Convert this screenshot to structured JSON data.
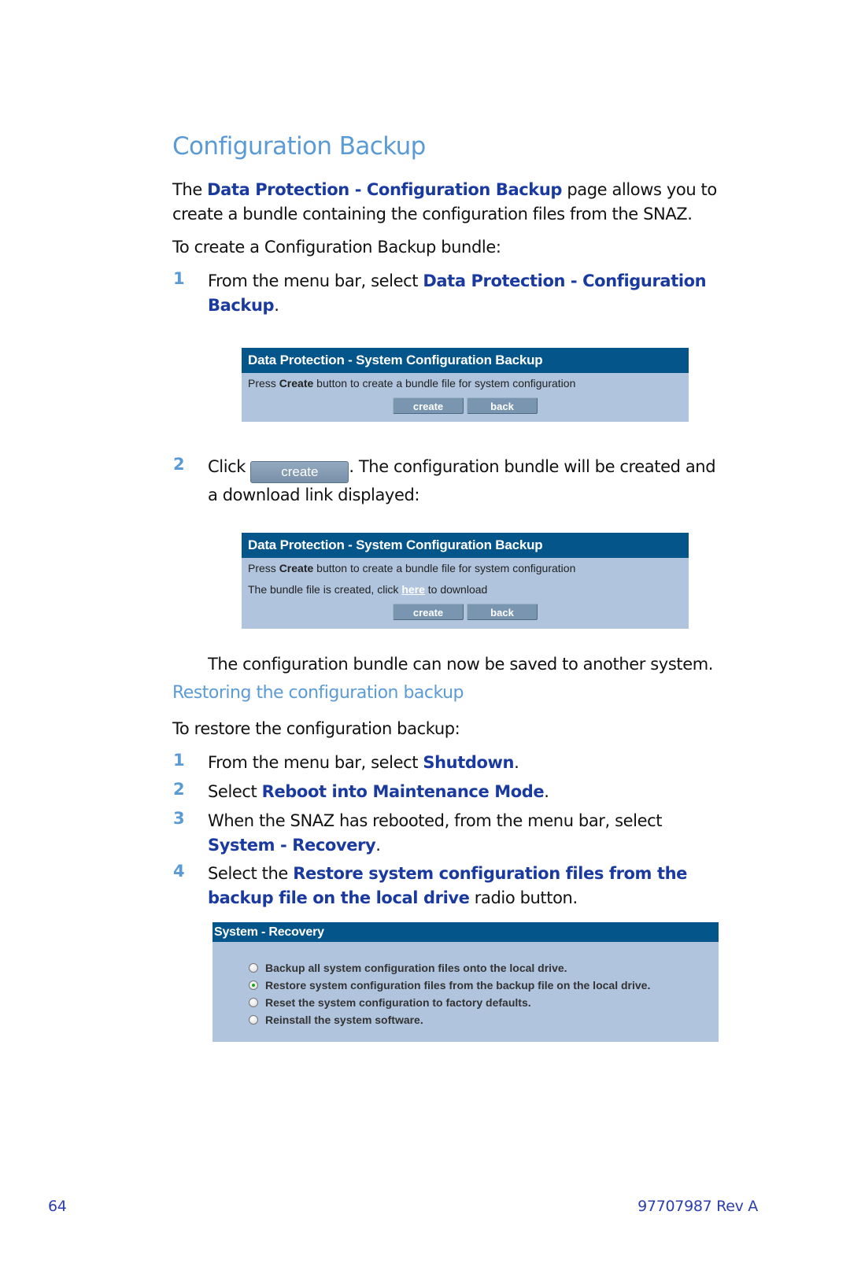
{
  "title": "Configuration Backup",
  "intro": {
    "prefix": "The ",
    "link": "Data Protection - Configuration Backup",
    "suffix_line1": " page allows you to",
    "line2": "create a bundle containing the configuration files from the SNAZ."
  },
  "create_intro": "To create a Configuration Backup bundle:",
  "create_steps": [
    {
      "number": "1",
      "text": "From the menu bar, select ",
      "link": "Data Protection - Configuration",
      "link2": "Backup",
      "end": "."
    },
    {
      "number": "2",
      "prefix": "Click ",
      "button": "create",
      "suffix": ". The configuration bundle will be created and",
      "line2": "a download link displayed:"
    }
  ],
  "panel1": {
    "header": "Data Protection - System Configuration Backup",
    "line1_prefix": "Press ",
    "line1_bold": "Create",
    "line1_suffix": " button to create a bundle file for system configuration",
    "buttons": [
      "create",
      "back"
    ]
  },
  "panel2": {
    "header": "Data Protection - System Configuration Backup",
    "line1_prefix": "Press ",
    "line1_bold": "Create",
    "line1_suffix": " button to create a bundle file for system configuration",
    "line2_prefix": "The bundle file is created, click ",
    "line2_link": "here",
    "line2_suffix": " to download",
    "buttons": [
      "create",
      "back"
    ]
  },
  "saved_note": "The configuration bundle can now be saved to another system.",
  "restore": {
    "heading": "Restoring the configuration backup",
    "intro": "To restore the configuration backup:",
    "steps": [
      {
        "number": "1",
        "text": "From the menu bar, select ",
        "link": "Shutdown",
        "end": "."
      },
      {
        "number": "2",
        "text": "Select ",
        "link": "Reboot into Maintenance Mode",
        "end": "."
      },
      {
        "number": "3",
        "text": "When the SNAZ has rebooted, from the menu bar, select",
        "link": "System - Recovery",
        "end": "."
      },
      {
        "number": "4",
        "text": "Select the ",
        "link": "Restore system configuration files from the",
        "link2": "backup file on the local drive",
        "end": " radio button."
      }
    ]
  },
  "panel3": {
    "header": "System - Recovery",
    "options": [
      {
        "label": "Backup all system configuration files onto the local drive.",
        "selected": false
      },
      {
        "label": "Restore system configuration files from the backup file on the local drive.",
        "selected": true
      },
      {
        "label": "Reset the system configuration to factory defaults.",
        "selected": false
      },
      {
        "label": "Reinstall the system software.",
        "selected": false
      }
    ]
  },
  "footer": {
    "page_number": "64",
    "doc_id": "97707987 Rev A"
  }
}
